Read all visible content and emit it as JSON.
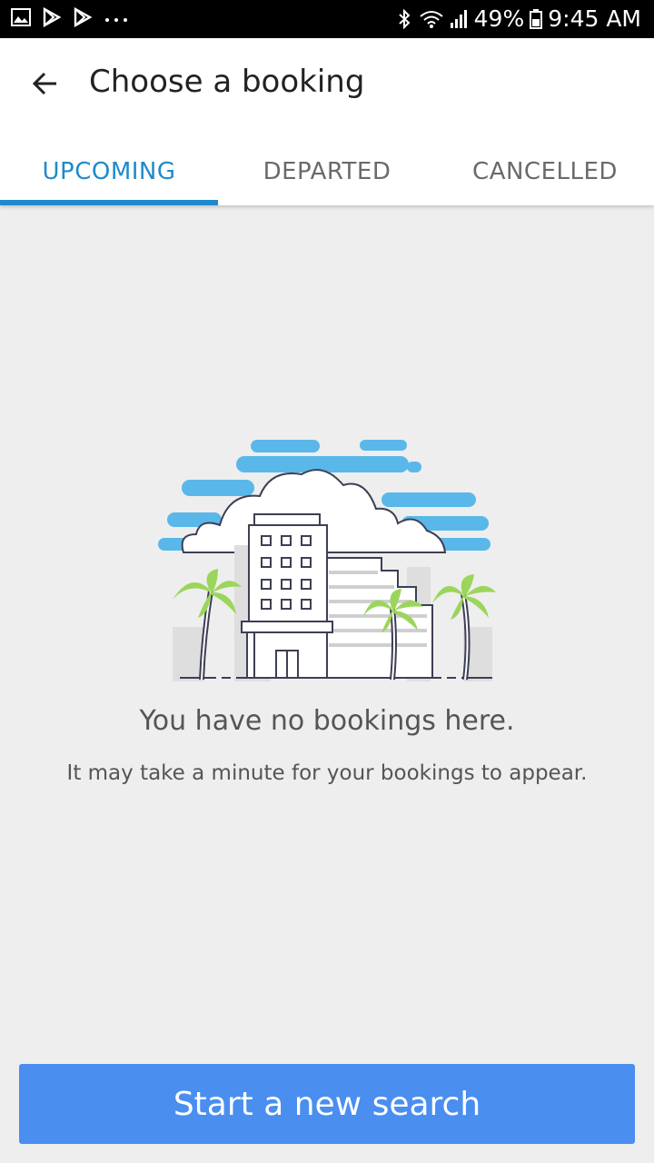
{
  "status_bar": {
    "battery": "49%",
    "time": "9:45 AM",
    "icons": [
      "image-icon",
      "play-store-icon",
      "play-store-icon",
      "more-dots-icon",
      "bluetooth-icon",
      "wifi-icon",
      "signal-icon",
      "battery-icon"
    ]
  },
  "header": {
    "title": "Choose a booking"
  },
  "tabs": [
    {
      "label": "UPCOMING",
      "active": true
    },
    {
      "label": "DEPARTED",
      "active": false
    },
    {
      "label": "CANCELLED",
      "active": false
    }
  ],
  "empty_state": {
    "title": "You have no bookings here.",
    "subtitle": "It may take a minute for your bookings to appear."
  },
  "cta": {
    "label": "Start a new search"
  },
  "colors": {
    "accent": "#1f8acb",
    "button": "#4a8ef0",
    "sky": "#5ab7ea",
    "palm": "#9bd55b"
  }
}
